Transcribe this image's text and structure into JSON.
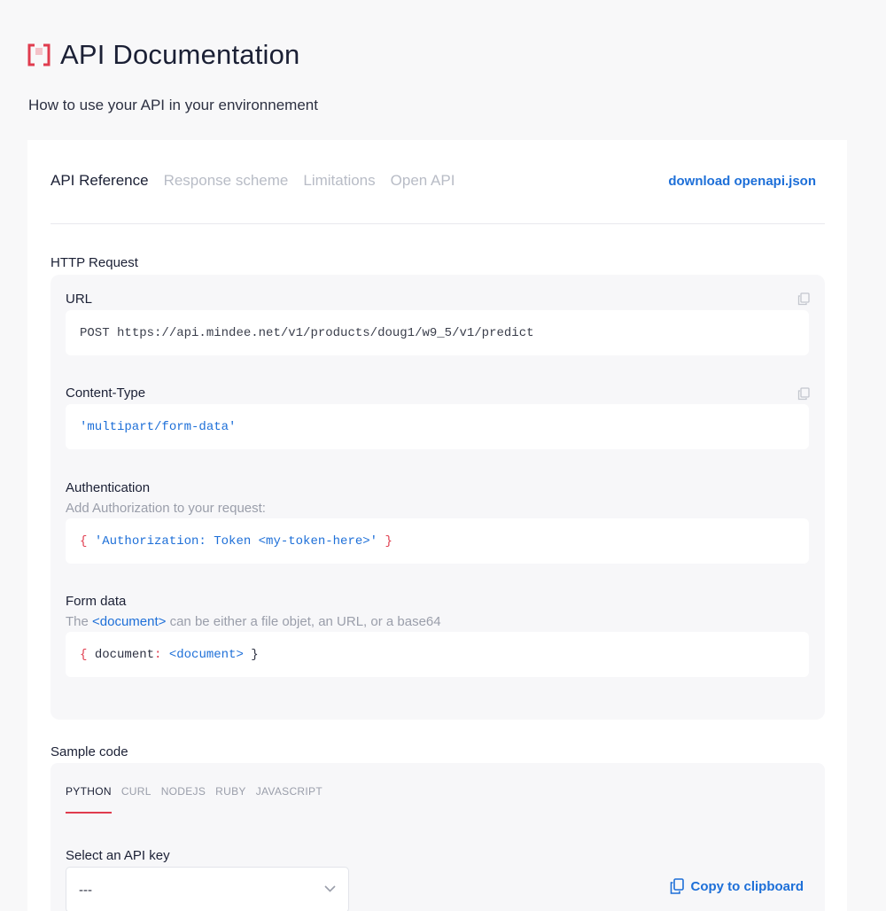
{
  "header": {
    "title": "API Documentation",
    "subtitle": "How to use your API in your environnement"
  },
  "tabs": [
    {
      "label": "API Reference",
      "active": true
    },
    {
      "label": "Response scheme",
      "active": false
    },
    {
      "label": "Limitations",
      "active": false
    },
    {
      "label": "Open API",
      "active": false
    }
  ],
  "download_link": "download openapi.json",
  "http_request": {
    "title": "HTTP Request",
    "url": {
      "label": "URL",
      "method": "POST",
      "endpoint": "https://api.mindee.net/v1/products/doug1/w9_5/v1/predict"
    },
    "content_type": {
      "label": "Content-Type",
      "value": "'multipart/form-data'"
    },
    "authentication": {
      "label": "Authentication",
      "description": "Add Authorization to your request:",
      "open_brace": "{",
      "value": "'Authorization: Token <my-token-here>'",
      "close_brace": "}"
    },
    "form_data": {
      "label": "Form data",
      "desc_prefix": "The ",
      "desc_highlight": "<document>",
      "desc_suffix": " can be either a file objet, an URL, or a base64",
      "open_brace": "{",
      "key": "document",
      "colon": ":",
      "value": "<document>",
      "close_brace": "}"
    }
  },
  "sample_code": {
    "title": "Sample code",
    "languages": [
      {
        "label": "PYTHON",
        "active": true
      },
      {
        "label": "CURL",
        "active": false
      },
      {
        "label": "NODEJS",
        "active": false
      },
      {
        "label": "RUBY",
        "active": false
      },
      {
        "label": "JAVASCRIPT",
        "active": false
      }
    ],
    "api_key_label": "Select an API key",
    "api_key_value": "---",
    "copy_label": "Copy to clipboard"
  },
  "colors": {
    "accent_blue": "#1d6fd8",
    "accent_red": "#e03c4e",
    "background": "#f8f8f9"
  }
}
